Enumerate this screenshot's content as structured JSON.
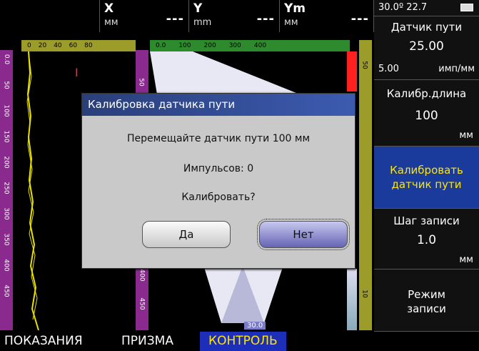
{
  "header": {
    "x": {
      "name": "X",
      "unit": "мм",
      "value": "---"
    },
    "y": {
      "name": "Y",
      "unit": "mm",
      "value": "---"
    },
    "ym": {
      "name": "Ym",
      "unit": "мм",
      "value": "---"
    },
    "status": "30.0º 22.7"
  },
  "side": {
    "sensor_title": "Датчик пути",
    "sensor_value": "25.00",
    "pulse_left": "5.00",
    "pulse_unit": "имп/мм",
    "calib_len_title": "Калибр.длина",
    "calib_len_value": "100",
    "calib_len_unit": "мм",
    "calib_btn_line1": "Калибровать",
    "calib_btn_line2": "датчик пути",
    "step_title": "Шаг записи",
    "step_value": "1.0",
    "step_unit": "мм",
    "mode_line1": "Режим",
    "mode_line2": "записи"
  },
  "ruler": {
    "top_left_ticks": [
      "0",
      "20",
      "40",
      "60",
      "80"
    ],
    "top_main_ticks": [
      "0.0",
      "100",
      "200",
      "300",
      "400"
    ],
    "left_ticks": [
      "0.0",
      "50",
      "100",
      "150",
      "200",
      "250",
      "300",
      "350",
      "400",
      "450"
    ],
    "mid_ticks": [
      "50",
      "400",
      "450"
    ],
    "right_ticks": [
      "50",
      "10"
    ],
    "angle_label": "30.0"
  },
  "dialog": {
    "title": "Калибровка датчика пути",
    "line1": "Перемещайте датчик пути 100 мм",
    "line2": "Импульсов: 0",
    "line3": "Калибровать?",
    "yes": "Да",
    "no": "Нет"
  },
  "tabs": [
    "ПОКАЗАНИЯ",
    "ПРИЗМА",
    "КОНТРОЛЬ"
  ],
  "colors": {
    "accent": "#1a3a9c",
    "dialog_title": "#2f4a98",
    "tab_active": "#1d2fb8"
  }
}
